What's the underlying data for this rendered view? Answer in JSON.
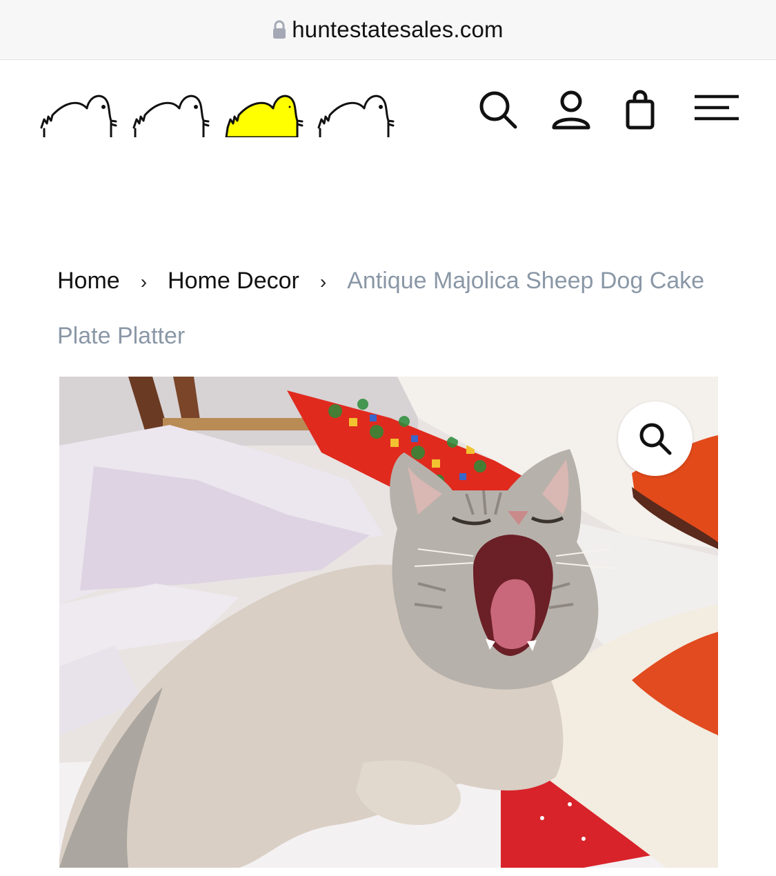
{
  "browser": {
    "url": "huntestatesales.com",
    "lock_icon": "lock-icon"
  },
  "header": {
    "logo_icon": "duck-row-logo",
    "logo_accent_color": "#ffff00",
    "icons": [
      "search-icon",
      "account-icon",
      "cart-icon",
      "menu-icon"
    ]
  },
  "breadcrumb": {
    "home": "Home",
    "category": "Home Decor",
    "current": "Antique Majolica Sheep Dog Cake Plate Platter",
    "separator": "›"
  },
  "product": {
    "image_icon": "cat-photo",
    "zoom_icon": "magnifier-icon"
  },
  "colors": {
    "breadcrumb_current": "#8a97a6",
    "text": "#111111"
  }
}
